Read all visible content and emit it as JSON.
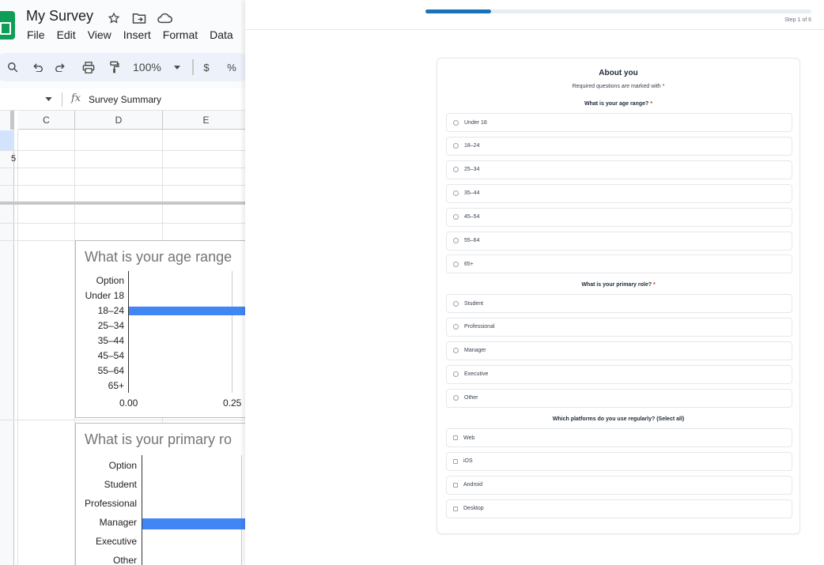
{
  "sheet": {
    "title": "My Survey",
    "menu": [
      "File",
      "Edit",
      "View",
      "Insert",
      "Format",
      "Data"
    ],
    "zoom": "100%",
    "currency": "$",
    "percent": "%",
    "formula": "Survey Summary",
    "columns": [
      "C",
      "D",
      "E"
    ],
    "row_fragment": "5",
    "charts": [
      {
        "title": "What is your age range",
        "header": "Option",
        "categories": [
          "Under 18",
          "18–24",
          "25–34",
          "35–44",
          "45–54",
          "55–64",
          "65+"
        ],
        "ticks": [
          "0.00",
          "0.25"
        ]
      },
      {
        "title": "What is your primary ro",
        "header": "Option",
        "categories": [
          "Student",
          "Professional",
          "Manager",
          "Executive",
          "Other"
        ]
      }
    ]
  },
  "survey": {
    "step": "Step 1 of 6",
    "progress": 0.17,
    "section_title": "About you",
    "required_note": "Required questions are marked with *",
    "questions": [
      {
        "label": "What is your age range?",
        "required": "*",
        "type": "radio",
        "options": [
          "Under 18",
          "18–24",
          "25–34",
          "35–44",
          "45–54",
          "55–64",
          "65+"
        ]
      },
      {
        "label": "What is your primary role?",
        "required": "*",
        "type": "radio",
        "options": [
          "Student",
          "Professional",
          "Manager",
          "Executive",
          "Other"
        ]
      },
      {
        "label": "Which platforms do you use regularly? (Select all)",
        "required": "",
        "type": "checkbox",
        "options": [
          "Web",
          "iOS",
          "Android",
          "Desktop"
        ]
      }
    ]
  }
}
